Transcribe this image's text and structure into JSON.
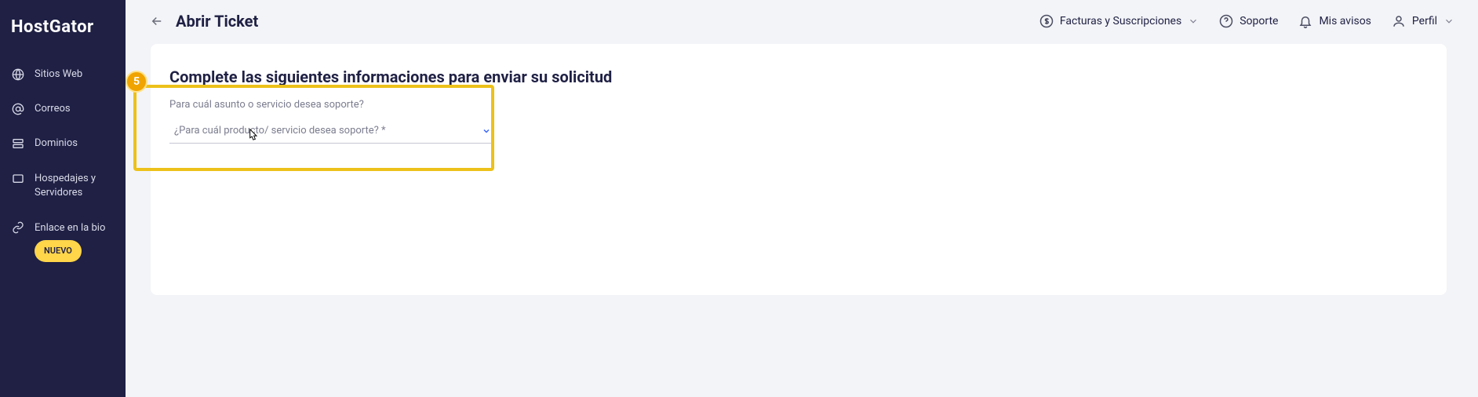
{
  "brand": "HostGator",
  "sidebar": {
    "items": [
      {
        "label": "Sitios Web"
      },
      {
        "label": "Correos"
      },
      {
        "label": "Dominios"
      },
      {
        "label": "Hospedajes y Servidores"
      },
      {
        "label": "Enlace en la bio",
        "badge": "NUEVO"
      }
    ]
  },
  "page": {
    "title": "Abrir Ticket"
  },
  "top": {
    "facturas": "Facturas y Suscripciones",
    "soporte": "Soporte",
    "avisos": "Mis avisos",
    "perfil": "Perfil"
  },
  "form": {
    "heading": "Complete las siguientes informaciones para enviar su solicitud",
    "field_label": "Para cuál asunto o servicio desea soporte?",
    "select_placeholder": "¿Para cuál producto/ servicio desea soporte? *"
  },
  "step": "5"
}
